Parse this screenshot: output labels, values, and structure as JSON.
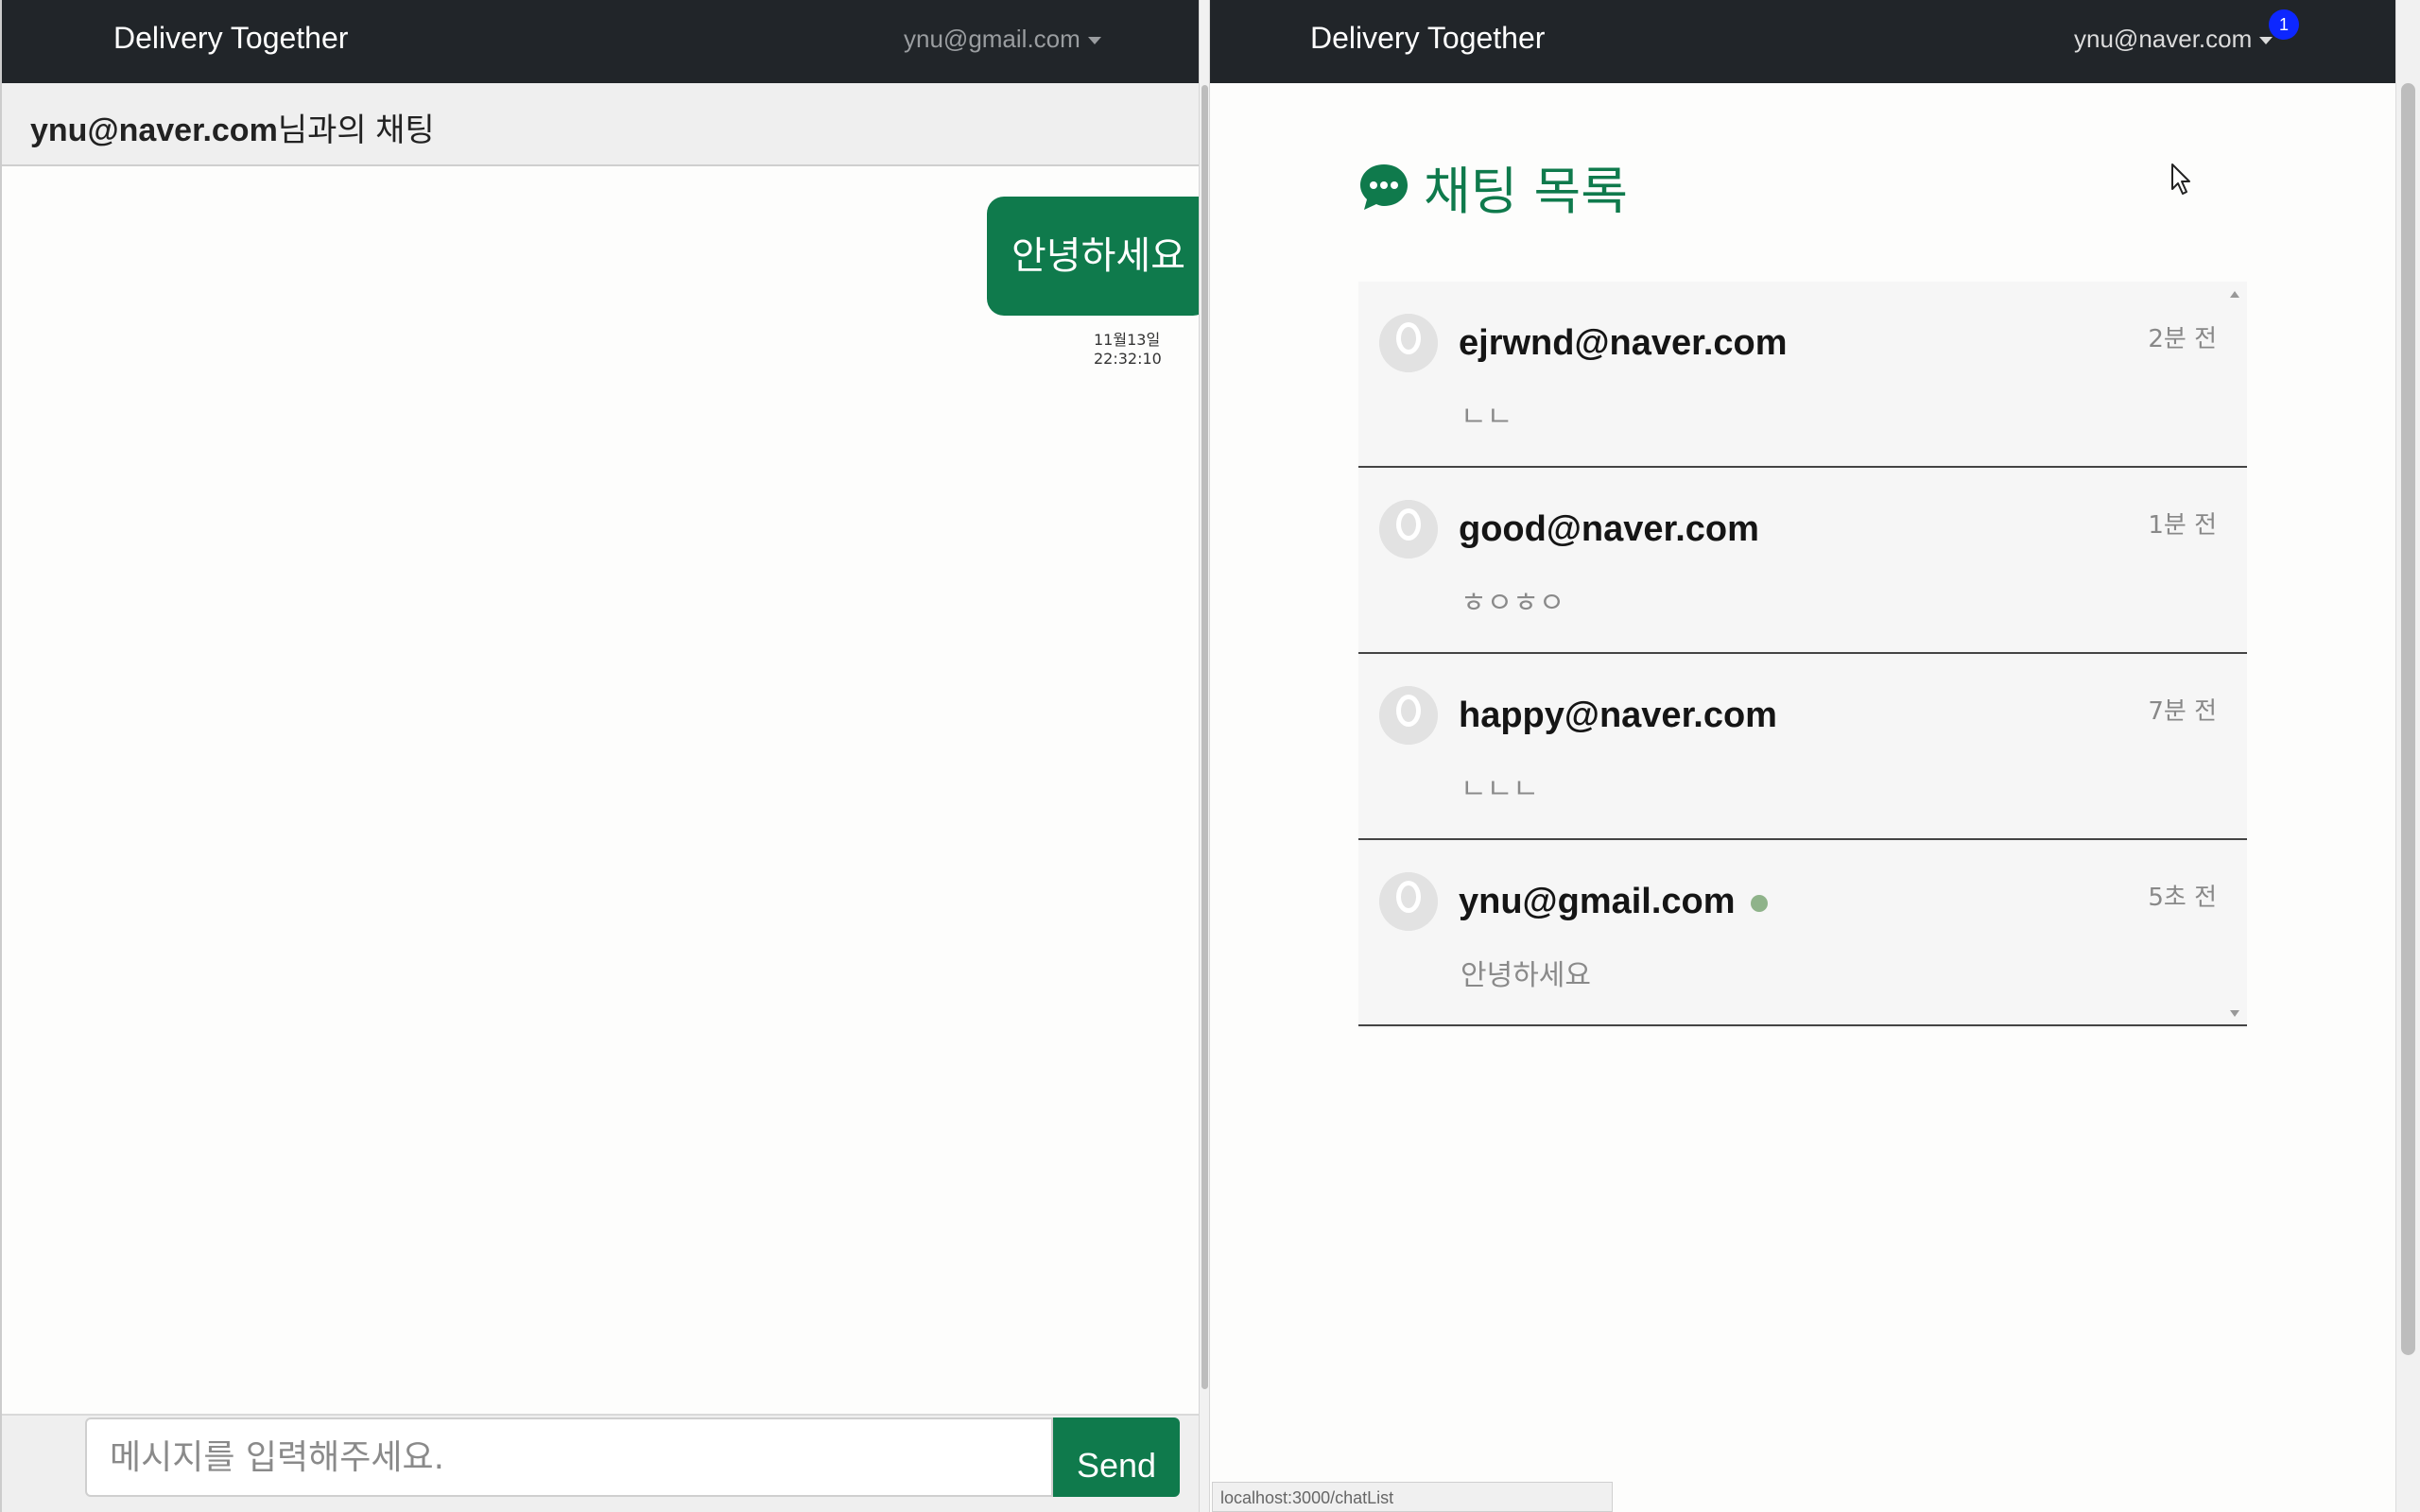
{
  "left_window": {
    "brand": "Delivery Together",
    "user_email": "ynu@gmail.com",
    "chat_header": {
      "email": "ynu@naver.com",
      "suffix": "님과의 채팅"
    },
    "messages": [
      {
        "text": "안녕하세요",
        "time": "11월13일 22:32:10",
        "from_me": true
      }
    ],
    "input": {
      "placeholder": "메시지를 입력해주세요.",
      "value": ""
    },
    "send_label": "Send"
  },
  "right_window": {
    "brand": "Delivery Together",
    "user_email": "ynu@naver.com",
    "notification_count": "1",
    "list_title": "채팅 목록",
    "chats": [
      {
        "email": "ejrwnd@naver.com",
        "time": "2분 전",
        "last_message": "ㄴㄴ",
        "online": false
      },
      {
        "email": "good@naver.com",
        "time": "1분 전",
        "last_message": "ㅎㅇㅎㅇ",
        "online": false
      },
      {
        "email": "happy@naver.com",
        "time": "7분 전",
        "last_message": "ㄴㄴㄴ",
        "online": false
      },
      {
        "email": "ynu@gmail.com",
        "time": "5초 전",
        "last_message": "안녕하세요",
        "online": true
      }
    ],
    "status_url": "localhost:3000/chatList"
  },
  "colors": {
    "navbar": "#212529",
    "accent_green": "#0f7a4c",
    "badge_blue": "#0d27ff",
    "online_dot": "#8fb38a"
  },
  "icons": [
    "chevron-down-icon",
    "chat-bubble-icon",
    "avatar-icon",
    "cursor-icon"
  ]
}
